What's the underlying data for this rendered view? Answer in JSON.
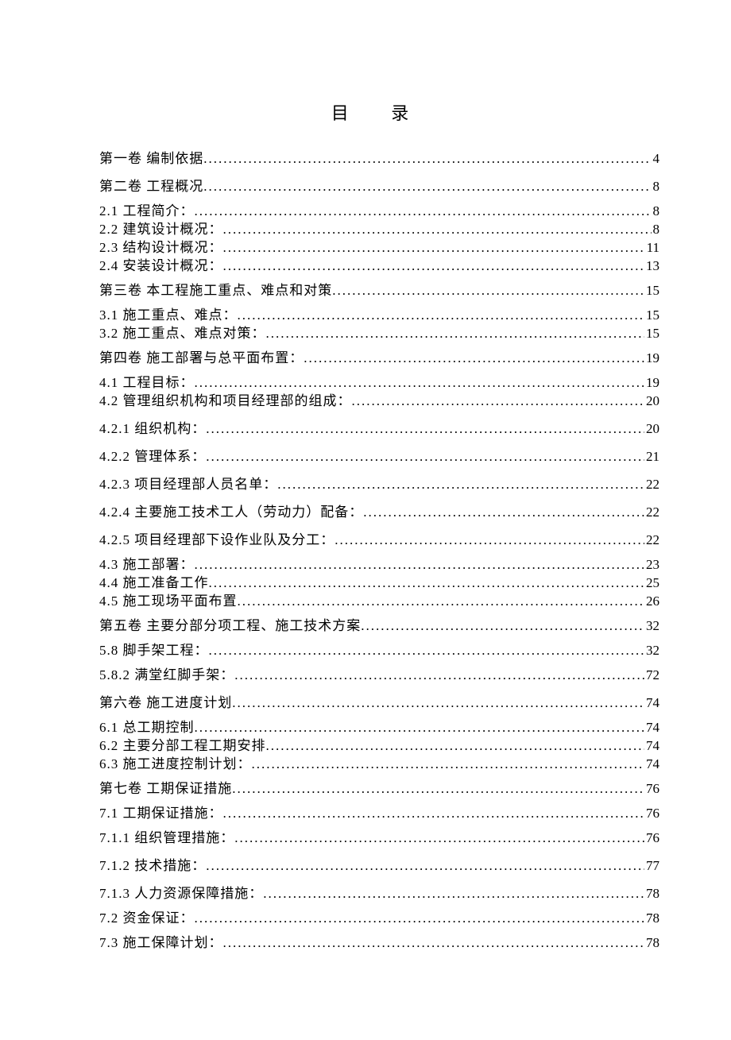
{
  "title": "目  录",
  "toc": [
    {
      "label": "第一卷 编制依据 ",
      "page": "4",
      "gap": "wide"
    },
    {
      "label": "第二卷 工程概况 ",
      "page": "8",
      "gap": "med"
    },
    {
      "label": "2.1 工程简介：",
      "page": "8",
      "gap": "tight"
    },
    {
      "label": "2.2 建筑设计概况：",
      "page": "8",
      "gap": "tight"
    },
    {
      "label": "2.3 结构设计概况：",
      "page": "11",
      "gap": "tight"
    },
    {
      "label": "2.4 安装设计概况：",
      "page": "13",
      "gap": "med"
    },
    {
      "label": "第三卷 本工程施工重点、难点和对策 ",
      "page": "15",
      "gap": "med"
    },
    {
      "label": "3.1 施工重点、难点：",
      "page": "15",
      "gap": "tight"
    },
    {
      "label": "3.2 施工重点、难点对策：",
      "page": "15",
      "gap": "med"
    },
    {
      "label": "第四卷 施工部署与总平面布置：",
      "page": "19",
      "gap": "med"
    },
    {
      "label": "4.1 工程目标：",
      "page": "19",
      "gap": "tight"
    },
    {
      "label": "4.2 管理组织机构和项目经理部的组成：",
      "page": "20",
      "gap": "wide"
    },
    {
      "label": "4.2.1 组织机构：",
      "page": "20",
      "gap": "wide"
    },
    {
      "label": "4.2.2 管理体系：",
      "page": "21",
      "gap": "wide"
    },
    {
      "label": "4.2.3 项目经理部人员名单：",
      "page": "22",
      "gap": "wide"
    },
    {
      "label": "4.2.4 主要施工技术工人（劳动力）配备：",
      "page": "22",
      "gap": "wide"
    },
    {
      "label": "4.2.5 项目经理部下设作业队及分工：",
      "page": "22",
      "gap": "med"
    },
    {
      "label": "4.3 施工部署：",
      "page": "23",
      "gap": "tight"
    },
    {
      "label": "4.4 施工准备工作",
      "page": "25",
      "gap": "tight"
    },
    {
      "label": "4.5 施工现场平面布置",
      "page": "26",
      "gap": "med"
    },
    {
      "label": "第五卷 主要分部分项工程、施工技术方案 ",
      "page": "32",
      "gap": "med"
    },
    {
      "label": "5.8 脚手架工程：",
      "page": "32",
      "gap": "med"
    },
    {
      "label": "5.8.2 满堂红脚手架：",
      "page": "72",
      "gap": "wide"
    },
    {
      "label": "第六卷 施工进度计划 ",
      "page": "74",
      "gap": "med"
    },
    {
      "label": "6.1 总工期控制",
      "page": "74",
      "gap": "tight"
    },
    {
      "label": "6.2 主要分部工程工期安排",
      "page": "74",
      "gap": "tight"
    },
    {
      "label": "6.3 施工进度控制计划：",
      "page": "74",
      "gap": "med"
    },
    {
      "label": "第七卷 工期保证措施 ",
      "page": "76",
      "gap": "med"
    },
    {
      "label": "7.1  工期保证措施：",
      "page": "76",
      "gap": "med"
    },
    {
      "label": "7.1.1 组织管理措施：",
      "page": "76",
      "gap": "wide"
    },
    {
      "label": "7.1.2 技术措施：",
      "page": "77",
      "gap": "wide"
    },
    {
      "label": "7.1.3 人力资源保障措施：",
      "page": "78",
      "gap": "med"
    },
    {
      "label": "7.2 资金保证：",
      "page": "78",
      "gap": "med"
    },
    {
      "label": "7.3 施工保障计划：",
      "page": "78",
      "gap": "med"
    }
  ]
}
